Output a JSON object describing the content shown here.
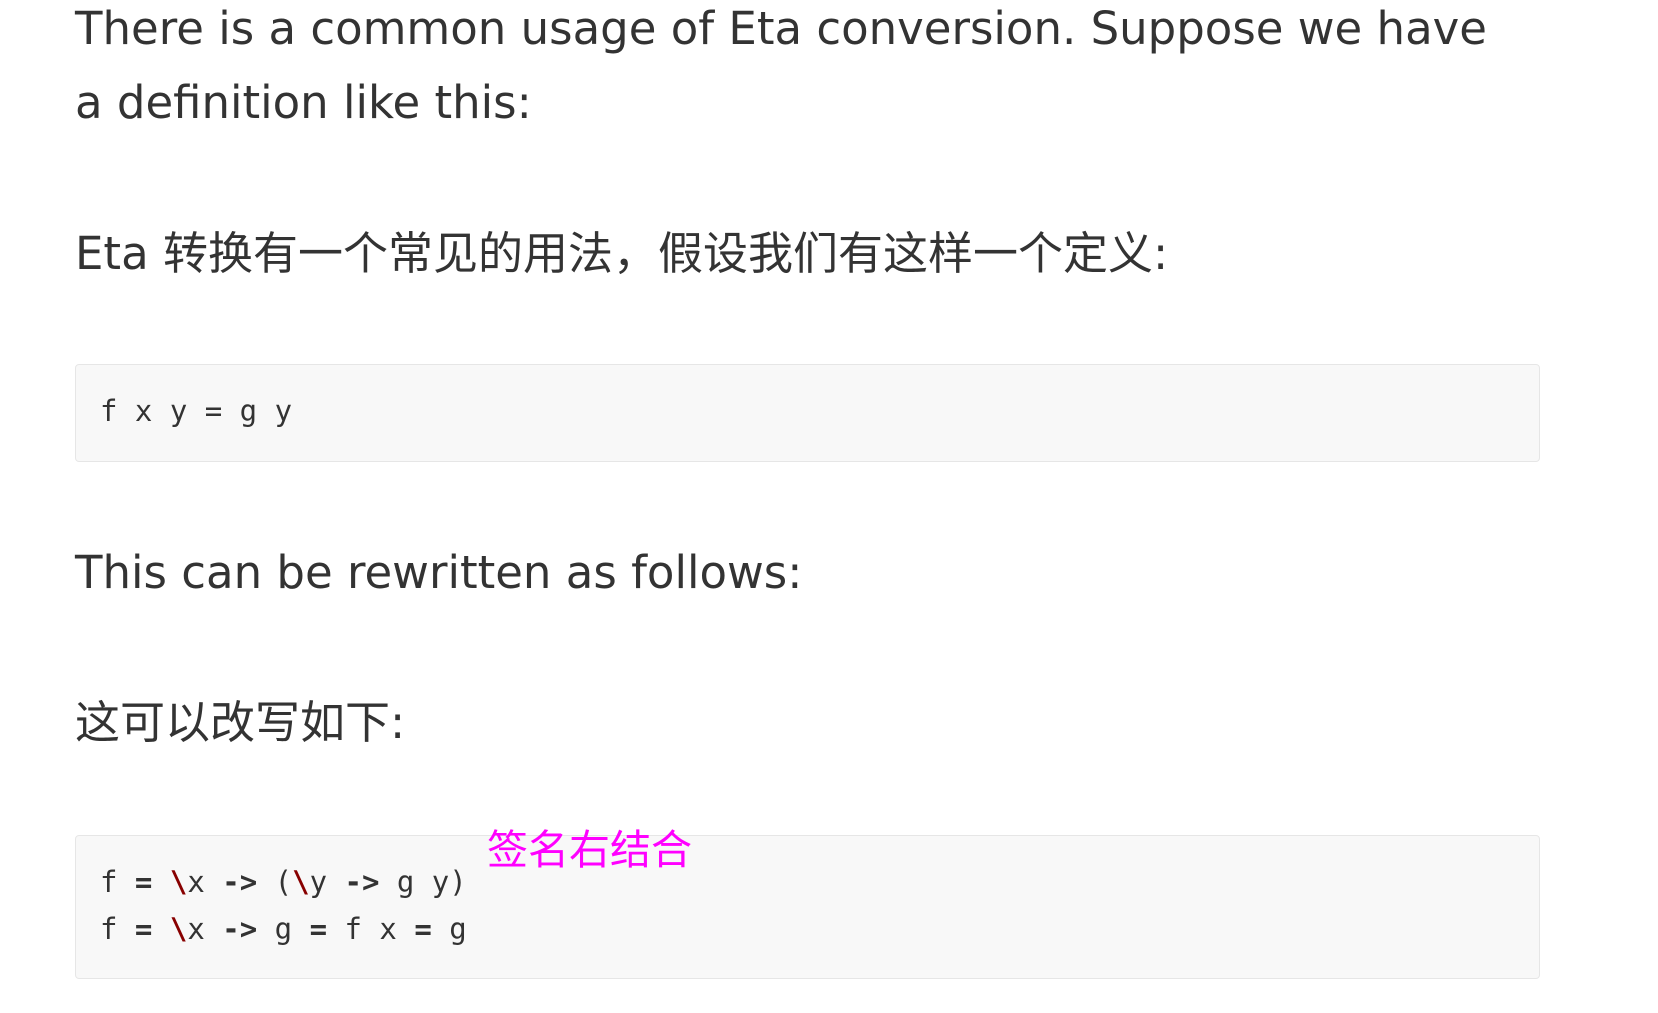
{
  "paragraphs": {
    "intro_en": "There is a common usage of Eta conversion. Suppose we have a definition like this:",
    "intro_zh": "Eta 转换有一个常见的用法，假设我们有这样一个定义:",
    "rewrite_en": "This can be rewritten as follows:",
    "rewrite_zh": "这可以改写如下:"
  },
  "code_block_1": {
    "line_1": "f x y = g y"
  },
  "code_block_2": {
    "line_1": {
      "t1": "f ",
      "t2": "=",
      "t3": " ",
      "t4": "\\",
      "t5": "x ",
      "t6": "->",
      "t7": " (",
      "t8": "\\",
      "t9": "y ",
      "t10": "->",
      "t11": " g y)"
    },
    "line_2": {
      "t1": "f ",
      "t2": "=",
      "t3": " ",
      "t4": "\\",
      "t5": "x ",
      "t6": "->",
      "t7": " g ",
      "t8": "=",
      "t9": " f x ",
      "t10": "=",
      "t11": " g"
    }
  },
  "annotation": {
    "text": "签名右结合",
    "color": "#ff00ff"
  },
  "colors": {
    "text": "#333333",
    "code_background": "#f8f8f8",
    "code_border": "#e6e6e6",
    "keyword": "#880000"
  }
}
